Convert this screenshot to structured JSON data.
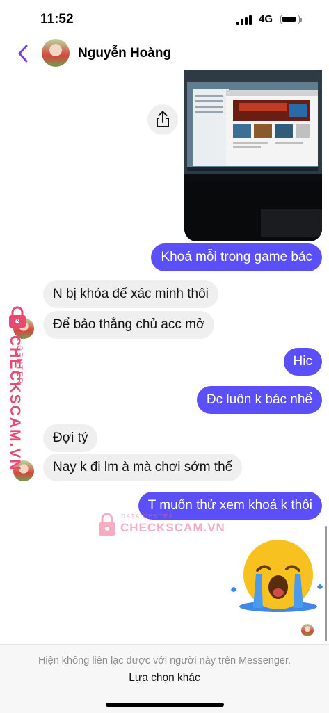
{
  "status_bar": {
    "time": "11:52",
    "network": "4G"
  },
  "header": {
    "contact_name": "Nguyễn Hoàng"
  },
  "messages": [
    {
      "direction": "outgoing",
      "text": "Khoá mỗi trong game bác"
    },
    {
      "direction": "incoming",
      "text": "N bị khóa để xác minh thôi"
    },
    {
      "direction": "incoming",
      "text": "Để bảo thằng chủ acc mở"
    },
    {
      "direction": "outgoing",
      "text": "Hic"
    },
    {
      "direction": "outgoing",
      "text": "Đc luôn k bác nhể"
    },
    {
      "direction": "incoming",
      "text": "Đợi tý"
    },
    {
      "direction": "incoming",
      "text": "Nay k đi lm à mà chơi sớm thế"
    },
    {
      "direction": "outgoing",
      "text": "T muốn thử xem khoá k thôi"
    }
  ],
  "watermark": {
    "brand": "CHECKSCAM.VN",
    "tagline": "DATA CENTER"
  },
  "footer": {
    "note": "Hiện không liên lạc được với người này trên Messenger.",
    "link": "Lựa chọn khác"
  },
  "colors": {
    "accent": "#5b4ff7",
    "back_chevron": "#7b3fe4",
    "watermark": "#e84a73"
  },
  "icons": {
    "back": "chevron-left-icon",
    "share": "share-icon",
    "sticker": "crying-face-sticker",
    "signal": "cellular-signal-icon",
    "battery": "battery-icon"
  }
}
